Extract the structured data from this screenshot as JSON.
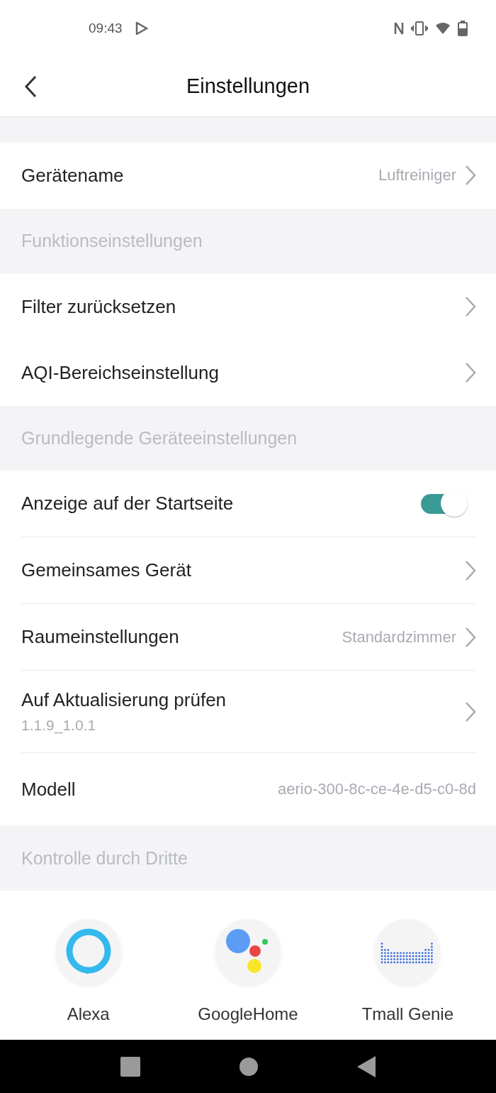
{
  "status_bar": {
    "time": "09:43"
  },
  "header": {
    "title": "Einstellungen"
  },
  "groups": [
    {
      "dividers": false,
      "items": [
        {
          "kind": "chevron",
          "label": "Gerätename",
          "value": "Luftreiniger"
        }
      ]
    },
    {
      "title": "Funktionseinstellungen",
      "dividers": false,
      "items": [
        {
          "kind": "chevron",
          "label": "Filter zurücksetzen"
        },
        {
          "kind": "chevron",
          "label": "AQI-Bereichseinstellung"
        }
      ]
    },
    {
      "title": "Grundlegende Geräteeinstellungen",
      "dividers": true,
      "items": [
        {
          "kind": "toggle",
          "label": "Anzeige auf der Startseite",
          "on": true
        },
        {
          "kind": "chevron",
          "label": "Gemeinsames Gerät"
        },
        {
          "kind": "chevron",
          "label": "Raumeinstellungen",
          "value": "Standardzimmer"
        },
        {
          "kind": "chevron",
          "label": "Auf Aktualisierung prüfen",
          "subtitle": "1.1.9_1.0.1"
        },
        {
          "kind": "static",
          "label": "Modell",
          "value": "aerio-300-8c-ce-4e-d5-c0-8d"
        }
      ]
    }
  ],
  "third_party": {
    "title": "Kontrolle durch Dritte",
    "services": [
      {
        "kind": "alexa",
        "label": "Alexa"
      },
      {
        "kind": "google",
        "label": "GoogleHome"
      },
      {
        "kind": "tmall",
        "label": "Tmall Genie"
      }
    ]
  }
}
